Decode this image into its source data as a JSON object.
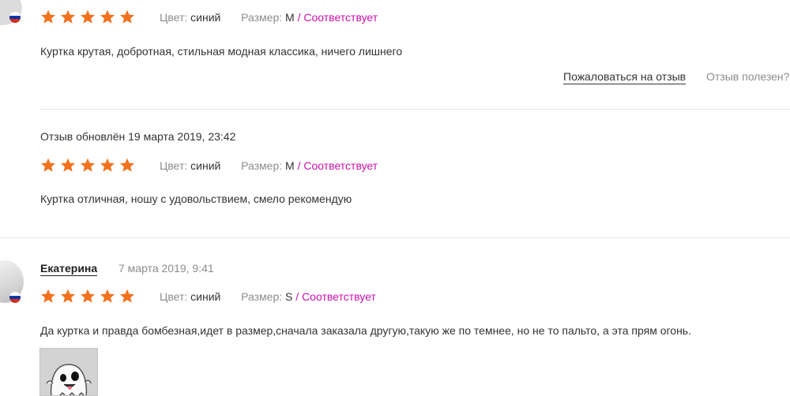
{
  "reviews": [
    {
      "rating": 5,
      "color_label": "Цвет:",
      "color_value": "синий",
      "size_label": "Размер:",
      "size_value": "M",
      "separator": "/",
      "fit": "Соответствует",
      "text": "Куртка крутая, добротная, стильная модная классика, ничего лишнего",
      "report_label": "Пожаловаться на отзыв",
      "helpful_label": "Отзыв полезен?"
    },
    {
      "updated": "Отзыв обновлён 19 марта 2019, 23:42",
      "rating": 5,
      "color_label": "Цвет:",
      "color_value": "синий",
      "size_label": "Размер:",
      "size_value": "M",
      "separator": "/",
      "fit": "Соответствует",
      "text": "Куртка отличная, ношу с удовольствием, смело рекомендую"
    },
    {
      "author": "Екатерина",
      "date": "7 марта 2019, 9:41",
      "rating": 5,
      "color_label": "Цвет:",
      "color_value": "синий",
      "size_label": "Размер:",
      "size_value": "S",
      "separator": "/",
      "fit": "Соответствует",
      "text": "Да куртка и правда бомбезная,идет в размер,сначала заказала другую,такую же по темнее, но не то пальто, а эта прям огонь.",
      "photo_icon": "ghost-emoji"
    }
  ],
  "colors": {
    "star": "#f2711c",
    "fit": "#cb11ab",
    "muted": "#8c8c8c",
    "divider": "#e6e6e6",
    "flag": [
      "#ffffff",
      "#0039a6",
      "#d52b1e"
    ]
  }
}
